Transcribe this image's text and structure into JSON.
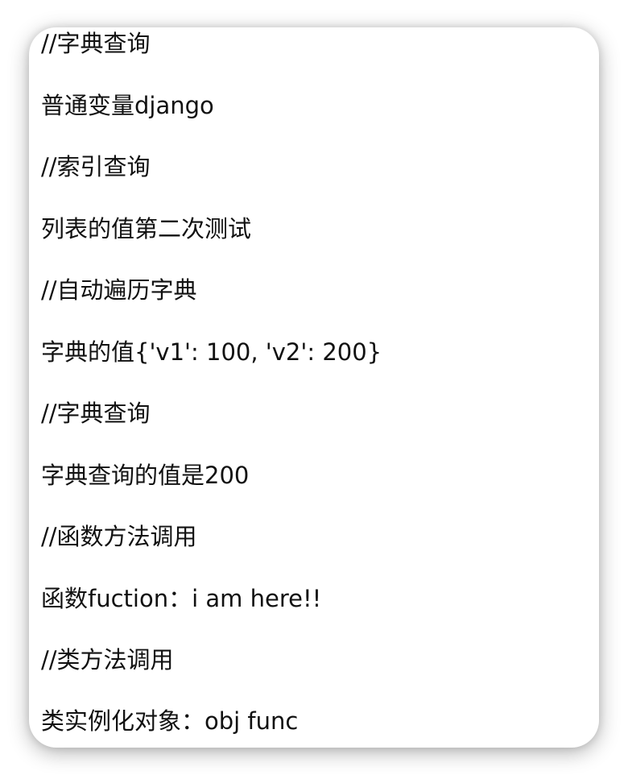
{
  "lines": [
    "//字典查询",
    "普通变量django",
    "//索引查询",
    "列表的值第二次测试",
    "//自动遍历字典",
    "字典的值{'v1': 100, 'v2': 200}",
    "//字典查询",
    "字典查询的值是200",
    "//函数方法调用",
    "函数fuction：i am here!!",
    "//类方法调用",
    "类实例化对象：obj func"
  ]
}
